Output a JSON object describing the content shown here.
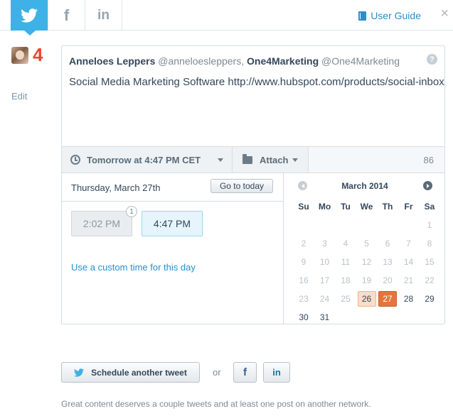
{
  "tabs": [
    {
      "name": "twitter",
      "icon": "twitter-bird-icon",
      "active": true
    },
    {
      "name": "facebook",
      "icon": "facebook-icon",
      "glyph": "f",
      "active": false
    },
    {
      "name": "linkedin",
      "icon": "linkedin-icon",
      "glyph": "in",
      "active": false
    }
  ],
  "header": {
    "user_guide_label": "User Guide",
    "close_glyph": "×"
  },
  "sidebar": {
    "brand_glyph": "4",
    "edit_label": "Edit"
  },
  "composer": {
    "account_name": "Anneloes Leppers",
    "account_handle": "@anneloesleppers,",
    "company_name": "One4Marketing",
    "company_handle": "@One4Marketing",
    "help_glyph": "?",
    "message": "Social Media Marketing Software http://www.hubspot.com/products/social-inbox"
  },
  "toolbar": {
    "schedule_label": "Tomorrow at 4:47 PM CET",
    "attach_label": "Attach",
    "char_count": "86"
  },
  "date_panel": {
    "date_label": "Thursday, March 27th",
    "go_today_label": "Go to today",
    "time_slots": [
      {
        "label": "2:02 PM",
        "state": "past",
        "badge": "1"
      },
      {
        "label": "4:47 PM",
        "state": "selected"
      }
    ],
    "custom_time_label": "Use a custom time for this day"
  },
  "calendar": {
    "title": "March 2014",
    "weekdays": [
      "Su",
      "Mo",
      "Tu",
      "We",
      "Th",
      "Fr",
      "Sa"
    ],
    "weeks": [
      [
        "",
        "",
        "",
        "",
        "",
        "",
        "1"
      ],
      [
        "2",
        "3",
        "4",
        "5",
        "6",
        "7",
        "8"
      ],
      [
        "9",
        "10",
        "11",
        "12",
        "13",
        "14",
        "15"
      ],
      [
        "16",
        "17",
        "18",
        "19",
        "20",
        "21",
        "22"
      ],
      [
        "23",
        "24",
        "25",
        "26",
        "27",
        "28",
        "29"
      ],
      [
        "30",
        "31",
        "",
        "",
        "",
        "",
        ""
      ]
    ],
    "disabled_through": 25,
    "today": "26",
    "selected": "27"
  },
  "actions": {
    "schedule_another_label": "Schedule another tweet",
    "or_label": "or",
    "facebook_glyph": "f",
    "linkedin_glyph": "in"
  },
  "footer": {
    "note": "Great content deserves a couple tweets and at least one post on another network."
  },
  "colors": {
    "twitter_blue": "#3eb1e6",
    "link_blue": "#2a8ec8",
    "selected_day": "#e3763e",
    "today_day": "#fbdcc6"
  }
}
